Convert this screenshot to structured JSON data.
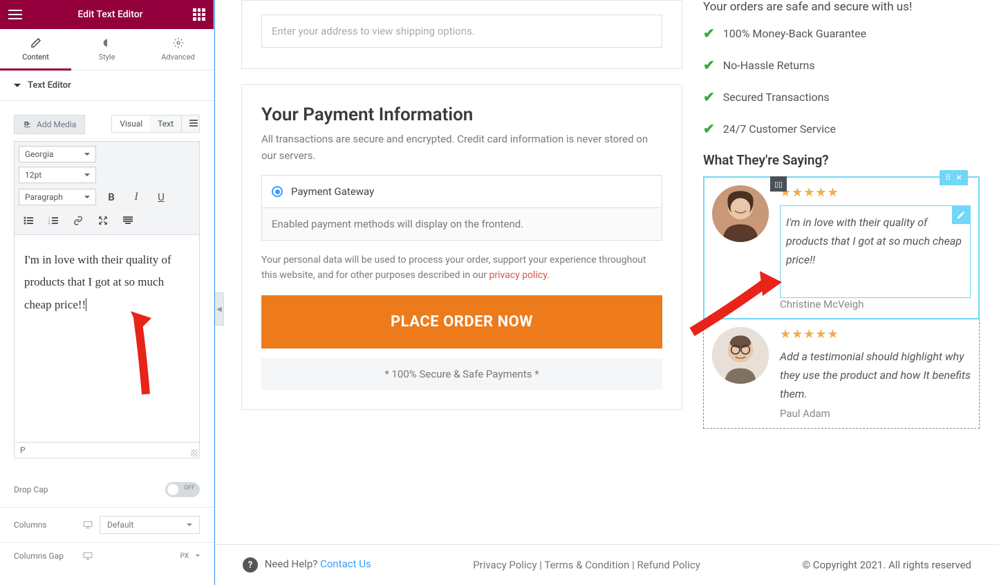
{
  "panel": {
    "title": "Edit Text Editor",
    "tabs": {
      "content": "Content",
      "style": "Style",
      "advanced": "Advanced"
    },
    "section": "Text Editor",
    "add_media": "Add Media",
    "wysiwyg": {
      "visual": "Visual",
      "text": "Text"
    },
    "font": "Georgia",
    "size": "12pt",
    "format": "Paragraph",
    "editor_text": "I'm in love with their quality of products that I got at so much cheap price!!",
    "status_path": "P",
    "drop_cap": "Drop Cap",
    "toggle_off": "OFF",
    "columns_label": "Columns",
    "columns_value": "Default",
    "columns_gap_label": "Columns Gap",
    "columns_gap_unit": "PX"
  },
  "preview": {
    "address_placeholder": "Enter your address to view shipping options.",
    "payment_heading": "Your Payment Information",
    "payment_sub": "All transactions are secure and encrypted. Credit card information is never stored on our servers.",
    "gateway_label": "Payment Gateway",
    "gateway_info": "Enabled payment methods will display on the frontend.",
    "privacy_text": "Your personal data will be used to process your order, support your experience throughout this website, and for other purposes described in our ",
    "privacy_link": "privacy policy",
    "place_order": "PLACE ORDER NOW",
    "secure_note": "* 100% Secure & Safe Payments *",
    "safe_heading": "Your orders are safe and secure with us!",
    "trust": [
      "100% Money-Back Guarantee",
      "No-Hassle Returns",
      "Secured Transactions",
      "24/7 Customer Service"
    ],
    "saying_heading": "What They're Saying?",
    "testimonials": [
      {
        "text": "I'm in love with their quality of products that I got at so much cheap price!!",
        "name": "Christine McVeigh"
      },
      {
        "text": "Add a testimonial should highlight why they use the product and how It benefits them.",
        "name": "Paul Adam"
      }
    ]
  },
  "footer": {
    "help": "Need Help?",
    "contact": "Contact Us",
    "links": "Privacy Policy | Terms & Condition  | Refund Policy",
    "copy": "© Copyright 2021. All rights reserved"
  }
}
